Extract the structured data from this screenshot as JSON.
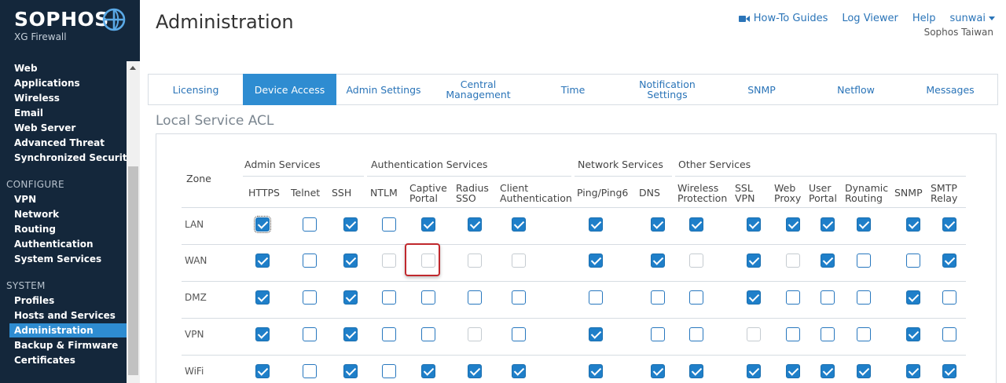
{
  "brand": {
    "name": "SOPHOS",
    "product": "XG Firewall"
  },
  "sidebar": {
    "items_protect": [
      "Web",
      "Applications",
      "Wireless",
      "Email",
      "Web Server",
      "Advanced Threat",
      "Synchronized Security"
    ],
    "section_configure": "CONFIGURE",
    "items_configure": [
      "VPN",
      "Network",
      "Routing",
      "Authentication",
      "System Services"
    ],
    "section_system": "SYSTEM",
    "items_system": [
      "Profiles",
      "Hosts and Services",
      "Administration",
      "Backup & Firmware",
      "Certificates"
    ],
    "active": "Administration"
  },
  "header": {
    "title": "Administration",
    "links": {
      "howto": "How-To Guides",
      "logviewer": "Log Viewer",
      "help": "Help",
      "user": "sunwai"
    },
    "org": "Sophos Taiwan"
  },
  "tabs": [
    {
      "label": "Licensing",
      "active": false
    },
    {
      "label": "Device Access",
      "active": true
    },
    {
      "label": "Admin Settings",
      "active": false
    },
    {
      "label": "Central\nManagement",
      "active": false
    },
    {
      "label": "Time",
      "active": false
    },
    {
      "label": "Notification\nSettings",
      "active": false
    },
    {
      "label": "SNMP",
      "active": false
    },
    {
      "label": "Netflow",
      "active": false
    },
    {
      "label": "Messages",
      "active": false
    }
  ],
  "acl": {
    "section_title": "Local Service ACL",
    "zone_header": "Zone",
    "groups": [
      "Admin Services",
      "Authentication Services",
      "Network Services",
      "Other Services"
    ],
    "columns": [
      "HTTPS",
      "Telnet",
      "SSH",
      "NTLM",
      "Captive\nPortal",
      "Radius\nSSO",
      "Client\nAuthentication",
      "Ping/Ping6",
      "DNS",
      "Wireless\nProtection",
      "SSL\nVPN",
      "Web\nProxy",
      "User\nPortal",
      "Dynamic\nRouting",
      "SNMP",
      "SMTP\nRelay"
    ],
    "rows": [
      {
        "zone": "LAN",
        "states": [
          "on",
          "off",
          "on",
          "off",
          "on",
          "on",
          "on",
          "on",
          "on",
          "on",
          "on",
          "on",
          "on",
          "on",
          "on",
          "on"
        ]
      },
      {
        "zone": "WAN",
        "states": [
          "on",
          "off",
          "on",
          "dis",
          "dis",
          "dis",
          "dis",
          "on",
          "on",
          "dis",
          "on",
          "dis",
          "on",
          "off",
          "off",
          "on"
        ]
      },
      {
        "zone": "DMZ",
        "states": [
          "on",
          "off",
          "on",
          "off",
          "off",
          "off",
          "off",
          "off",
          "off",
          "off",
          "on",
          "off",
          "off",
          "off",
          "on",
          "off"
        ]
      },
      {
        "zone": "VPN",
        "states": [
          "on",
          "off",
          "on",
          "off",
          "off",
          "dis",
          "off",
          "on",
          "off",
          "off",
          "dis",
          "off",
          "off",
          "off",
          "on",
          "off"
        ]
      },
      {
        "zone": "WiFi",
        "states": [
          "on",
          "off",
          "on",
          "off",
          "on",
          "on",
          "on",
          "on",
          "on",
          "on",
          "on",
          "on",
          "on",
          "on",
          "on",
          "on"
        ]
      }
    ],
    "highlighted": {
      "zone": "WAN",
      "column": "Captive\nPortal"
    }
  }
}
